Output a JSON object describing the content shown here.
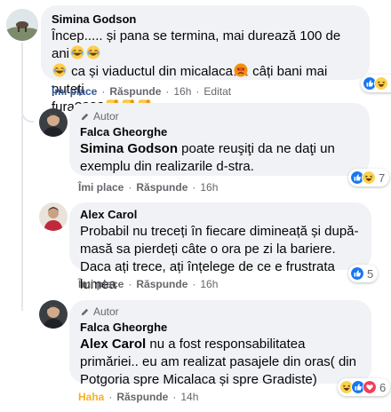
{
  "comments": [
    {
      "author": "Simina Godson",
      "text_1": "Încep..... și pana se termina, mai durează 100 de ani",
      "text_2": "ca și viaductul din micalaca",
      "text_3": " câți bani mai puteți",
      "text_4": "fura????",
      "actions": {
        "like": "Îmi place",
        "reply": "Răspunde",
        "time": "16h",
        "edited": "Editat"
      },
      "reactions_count": "2"
    },
    {
      "badge": "Autor",
      "author": "Falca Gheorghe",
      "mention": "Simina Godson",
      "text": " poate reuşiţi da ne daţi un exemplu din realizarile d-stra.",
      "actions": {
        "like": "Îmi place",
        "reply": "Răspunde",
        "time": "16h"
      },
      "reactions_count": "7"
    },
    {
      "author": "Alex Carol",
      "text": "Probabil nu treceți în fiecare dimineață și după-masă sa pierdeți câte o ora pe zi la bariere. Daca ați trece, ați înțelege de ce e frustrata lumea",
      "actions": {
        "like": "Îmi place",
        "reply": "Răspunde",
        "time": "16h"
      },
      "reactions_count": "5"
    },
    {
      "badge": "Autor",
      "author": "Falca Gheorghe",
      "mention": "Alex Carol",
      "text": " nu a fost responsabilitatea primăriei.. eu am realizat pasajele din oras( din Potgoria spre Micalaca și spre Gradiste)",
      "actions": {
        "like": "Haha",
        "reply": "Răspunde",
        "time": "14h"
      },
      "reactions_count": "6"
    }
  ],
  "separator": "·",
  "colors": {
    "bubble": "#f0f2f5",
    "like_blue": "#385898",
    "haha_yellow": "#f7b125",
    "secondary_text": "#65676b"
  },
  "icons": [
    "laughing-emoji",
    "angry-emoji",
    "thumbs-down-emoji",
    "pencil-icon",
    "like-reaction-icon",
    "haha-reaction-icon",
    "love-reaction-icon"
  ]
}
